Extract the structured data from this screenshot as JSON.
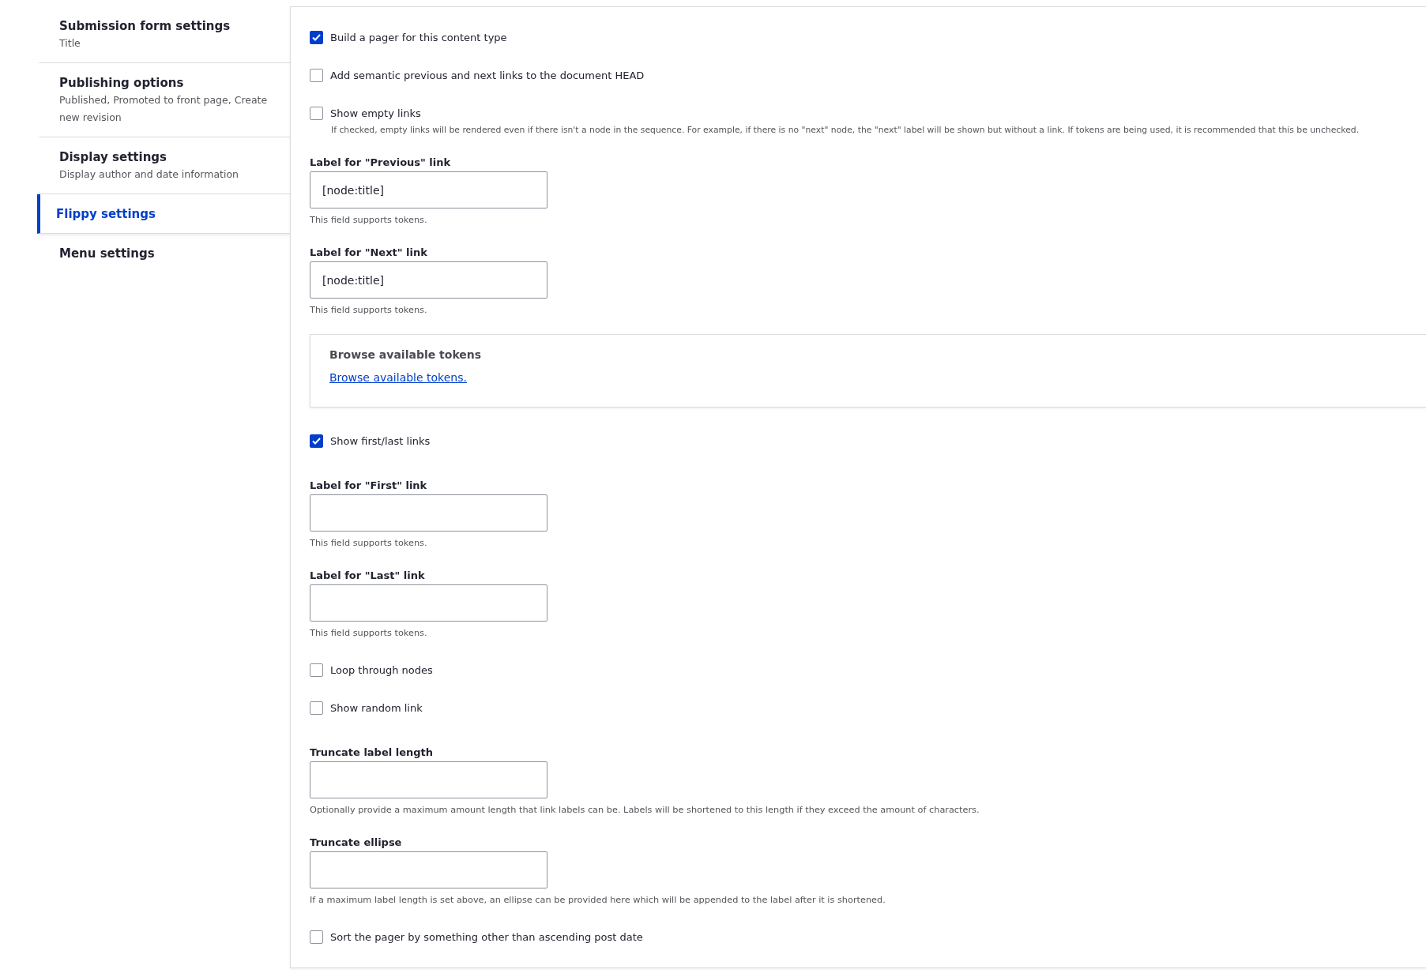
{
  "sidebar": {
    "items": [
      {
        "title": "Submission form settings",
        "summary": "Title",
        "selected": false
      },
      {
        "title": "Publishing options",
        "summary": "Published, Promoted to front page, Create new revision",
        "selected": false
      },
      {
        "title": "Display settings",
        "summary": "Display author and date information",
        "selected": false
      },
      {
        "title": "Flippy settings",
        "selected": true
      },
      {
        "title": "Menu settings",
        "selected": false
      }
    ]
  },
  "form": {
    "fields": [
      {
        "kind": "checkbox",
        "label": "Build a pager for this content type",
        "checked": true
      },
      {
        "kind": "checkbox",
        "label": "Add semantic previous and next links to the document HEAD",
        "checked": false
      },
      {
        "kind": "checkbox",
        "label": "Show empty links",
        "checked": false,
        "description": "If checked, empty links will be rendered even if there isn't a node in the sequence. For example, if there is no \"next\" node, the \"next\" label will be shown but without a link. If tokens are being used, it is recommended that this be unchecked."
      },
      {
        "kind": "text",
        "label": "Label for \"Previous\" link",
        "value": "[node:title]",
        "description": "This field supports tokens."
      },
      {
        "kind": "text",
        "label": "Label for \"Next\" link",
        "value": "[node:title]",
        "description": "This field supports tokens."
      },
      {
        "kind": "tokens",
        "title": "Browse available tokens",
        "link": "Browse available tokens."
      },
      {
        "kind": "checkbox",
        "label": "Show first/last links",
        "checked": true
      },
      {
        "kind": "text",
        "label": "Label for \"First\" link",
        "description": "This field supports tokens."
      },
      {
        "kind": "text",
        "label": "Label for \"Last\" link",
        "description": "This field supports tokens."
      },
      {
        "kind": "checkbox",
        "label": "Loop through nodes",
        "checked": false
      },
      {
        "kind": "checkbox",
        "label": "Show random link",
        "checked": false
      },
      {
        "kind": "text",
        "label": "Truncate label length",
        "description": "Optionally provide a maximum amount length that link labels can be. Labels will be shortened to this length if they exceed the amount of characters."
      },
      {
        "kind": "text",
        "label": "Truncate ellipse",
        "description": "If a maximum label length is set above, an ellipse can be provided here which will be appended to the label after it is shortened."
      },
      {
        "kind": "checkbox",
        "label": "Sort the pager by something other than ascending post date",
        "checked": false
      }
    ]
  }
}
